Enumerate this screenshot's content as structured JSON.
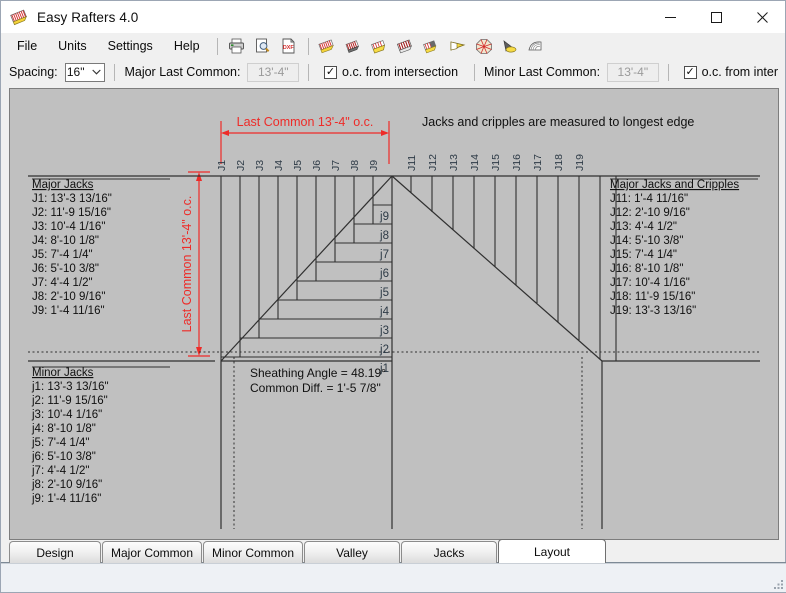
{
  "window": {
    "title": "Easy Rafters 4.0",
    "app_icon": "rafter-icon",
    "controls": {
      "minimize": "─",
      "maximize": "☐",
      "close": "✕"
    }
  },
  "menubar": {
    "items": [
      {
        "label": "File",
        "name": "menu-file"
      },
      {
        "label": "Units",
        "name": "menu-units"
      },
      {
        "label": "Settings",
        "name": "menu-settings"
      },
      {
        "label": "Help",
        "name": "menu-help"
      }
    ],
    "toolbar_icons": [
      "print-icon",
      "print-preview-icon",
      "dxf-export-icon",
      "rafter-red-icon",
      "rafter-dark-icon",
      "rafter-yellow-icon",
      "rafter-striped-icon",
      "rafter-valley-icon",
      "rafter-wedge-icon",
      "octagon-icon",
      "cone-icon",
      "fan-icon"
    ]
  },
  "options": {
    "spacing_label": "Spacing:",
    "spacing_value": "16\"",
    "major_last_common_label": "Major Last Common:",
    "major_last_common_value": "13'-4\"",
    "major_oc_label": "o.c. from intersection",
    "major_oc_checked": "✓",
    "minor_last_common_label": "Minor Last Common:",
    "minor_last_common_value": "13'-4\"",
    "minor_oc_label": "o.c. from inter",
    "minor_oc_checked": "✓"
  },
  "drawing": {
    "top_dimension_label": "Last Common  13'-4\" o.c.",
    "left_dimension_label": "Last Common 13'-4\" o.c.",
    "note": "Jacks and cripples are measured to longest edge",
    "sheathing_angle": "Sheathing Angle = 48.19°",
    "common_diff": "Common Diff. = 1'-5 7/8\"",
    "accent_color": "#ee2b28",
    "line_color": "#303030",
    "background": "#c0c0c0",
    "major_jacks": {
      "title": "Major Jacks",
      "items": [
        "J1: 13'-3 13/16\"",
        "J2: 11'-9 15/16\"",
        "J3: 10'-4 1/16\"",
        "J4: 8'-10 1/8\"",
        "J5: 7'-4 1/4\"",
        "J6: 5'-10 3/8\"",
        "J7: 4'-4 1/2\"",
        "J8: 2'-10 9/16\"",
        "J9: 1'-4 11/16\""
      ]
    },
    "minor_jacks": {
      "title": "Minor Jacks",
      "items": [
        "j1: 13'-3 13/16\"",
        "j2: 11'-9 15/16\"",
        "j3: 10'-4 1/16\"",
        "j4: 8'-10 1/8\"",
        "j5: 7'-4 1/4\"",
        "j6: 5'-10 3/8\"",
        "j7: 4'-4 1/2\"",
        "j8: 2'-10 9/16\"",
        "j9: 1'-4 11/16\""
      ]
    },
    "major_jacks_cripples": {
      "title": "Major Jacks and Cripples",
      "items": [
        "J11: 1'-4 11/16\"",
        "J12: 2'-10 9/16\"",
        "J13: 4'-4 1/2\"",
        "J14: 5'-10 3/8\"",
        "J15: 7'-4 1/4\"",
        "J16: 8'-10 1/8\"",
        "J17: 10'-4 1/16\"",
        "J18: 11'-9 15/16\"",
        "J19: 13'-3 13/16\""
      ]
    },
    "top_labels_left": [
      "J1",
      "J2",
      "J3",
      "J4",
      "J5",
      "J6",
      "J7",
      "J8",
      "J9"
    ],
    "top_labels_right": [
      "J11",
      "J12",
      "J13",
      "J14",
      "J15",
      "J16",
      "J17",
      "J18",
      "J19"
    ],
    "step_labels": [
      "j1",
      "j2",
      "j3",
      "j4",
      "j5",
      "j6",
      "j7",
      "j8",
      "j9"
    ]
  },
  "tabs": [
    {
      "label": "Design",
      "active": false
    },
    {
      "label": "Major Common",
      "active": false
    },
    {
      "label": "Minor Common",
      "active": false
    },
    {
      "label": "Valley",
      "active": false
    },
    {
      "label": "Jacks",
      "active": false
    },
    {
      "label": "Layout",
      "active": true
    }
  ]
}
